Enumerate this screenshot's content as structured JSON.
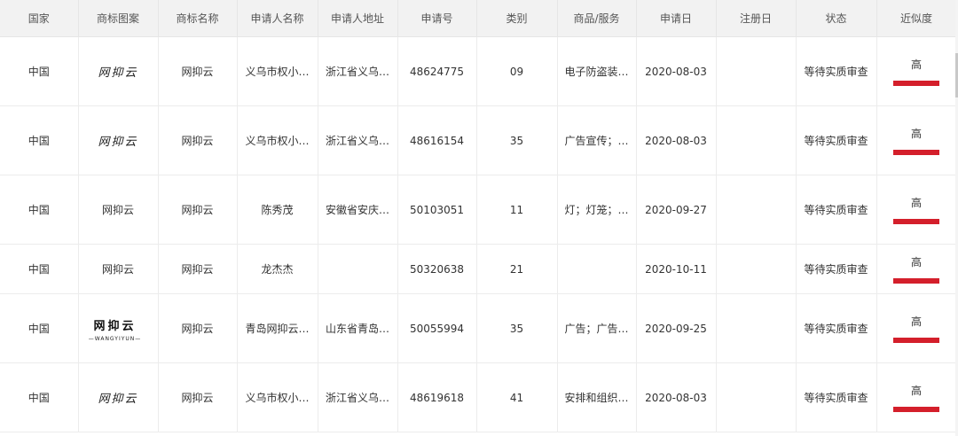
{
  "columns": [
    "国家",
    "商标图案",
    "商标名称",
    "申请人名称",
    "申请人地址",
    "申请号",
    "类别",
    "商品/服务",
    "申请日",
    "注册日",
    "状态",
    "近似度"
  ],
  "rows": [
    {
      "country": "中国",
      "logo_text": "网抑云",
      "logo_style": "calligraphy",
      "name": "网抑云",
      "applicant": "义乌市权小…",
      "address": "浙江省义乌…",
      "app_no": "48624775",
      "class": "09",
      "goods": "电子防盗装…",
      "apply_date": "2020-08-03",
      "reg_date": "",
      "status": "等待实质审查",
      "similarity": "高"
    },
    {
      "country": "中国",
      "logo_text": "网抑云",
      "logo_style": "calligraphy",
      "name": "网抑云",
      "applicant": "义乌市权小…",
      "address": "浙江省义乌…",
      "app_no": "48616154",
      "class": "35",
      "goods": "广告宣传；…",
      "apply_date": "2020-08-03",
      "reg_date": "",
      "status": "等待实质审查",
      "similarity": "高"
    },
    {
      "country": "中国",
      "logo_text": "网抑云",
      "logo_style": "plain",
      "name": "网抑云",
      "applicant": "陈秀茂",
      "address": "安徽省安庆…",
      "app_no": "50103051",
      "class": "11",
      "goods": "灯；灯笼；…",
      "apply_date": "2020-09-27",
      "reg_date": "",
      "status": "等待实质审查",
      "similarity": "高"
    },
    {
      "country": "中国",
      "logo_text": "网抑云",
      "logo_style": "plain",
      "name": "网抑云",
      "applicant": "龙杰杰",
      "address": "",
      "app_no": "50320638",
      "class": "21",
      "goods": "",
      "apply_date": "2020-10-11",
      "reg_date": "",
      "status": "等待实质审查",
      "similarity": "高"
    },
    {
      "country": "中国",
      "logo_text": "网抑云",
      "logo_subtext": "—WANGYIYUN—",
      "logo_style": "boxed",
      "name": "网抑云",
      "applicant": "青岛网抑云…",
      "address": "山东省青岛…",
      "app_no": "50055994",
      "class": "35",
      "goods": "广告；广告…",
      "apply_date": "2020-09-25",
      "reg_date": "",
      "status": "等待实质审查",
      "similarity": "高"
    },
    {
      "country": "中国",
      "logo_text": "网抑云",
      "logo_style": "calligraphy",
      "name": "网抑云",
      "applicant": "义乌市权小…",
      "address": "浙江省义乌…",
      "app_no": "48619618",
      "class": "41",
      "goods": "安排和组织…",
      "apply_date": "2020-08-03",
      "reg_date": "",
      "status": "等待实质审查",
      "similarity": "高"
    }
  ],
  "colors": {
    "similarity_bar": "#d41f2b",
    "header_bg": "#f2f2f2"
  }
}
